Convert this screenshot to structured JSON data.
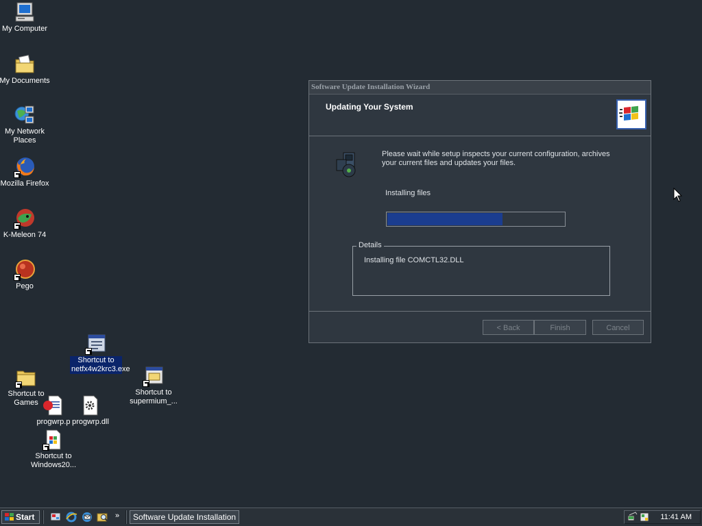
{
  "desktop": {
    "icons": [
      {
        "label": "My Computer"
      },
      {
        "label": "My Documents"
      },
      {
        "label": "My Network Places"
      },
      {
        "label": "Mozilla Firefox"
      },
      {
        "label": "K-Meleon 74"
      },
      {
        "label": "Pego"
      },
      {
        "label": "Shortcut to netfx4w2krc3.exe"
      },
      {
        "label": "Shortcut to supermium_..."
      },
      {
        "label": "Shortcut to Games"
      },
      {
        "label": "progwrp.p"
      },
      {
        "label": "progwrp.dll"
      },
      {
        "label": "Shortcut to Windows20..."
      }
    ]
  },
  "wizard": {
    "title": "Software Update Installation Wizard",
    "heading": "Updating Your System",
    "description": "Please wait while setup inspects your current configuration, archives your current files and updates your files.",
    "status_label": "Installing files",
    "progress_fraction": 0.65,
    "details_legend": "Details",
    "details_text": "Installing file COMCTL32.DLL",
    "buttons": {
      "back": "< Back",
      "finish": "Finish",
      "cancel": "Cancel"
    }
  },
  "taskbar": {
    "start_label": "Start",
    "quick_launch_more": "»",
    "task_label": "Software Update Installation ...",
    "clock": "11:41 AM"
  },
  "colors": {
    "desktop_background": "#232b33",
    "progress_fill": "#1b3d8f",
    "selection_highlight": "#0a246a"
  }
}
